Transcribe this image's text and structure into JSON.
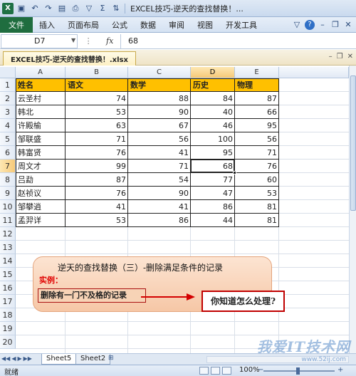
{
  "window": {
    "title": "EXCEL技巧-逆天的查找替换！..."
  },
  "quick_access": {
    "icons": [
      "excel-icon",
      "save-icon",
      "undo-icon",
      "redo-icon",
      "filter-icon",
      "print-icon",
      "sum-icon",
      "sort-icon"
    ]
  },
  "ribbon": {
    "file_label": "文件",
    "tabs": [
      "插入",
      "页面布局",
      "公式",
      "数据",
      "审阅",
      "视图",
      "开发工具"
    ]
  },
  "formula_bar": {
    "name_box": "D7",
    "fx": "fx",
    "value": "68"
  },
  "workbook": {
    "tab_label": "EXCEL技巧-逆天的查找替换！.xlsx"
  },
  "grid": {
    "columns": [
      "A",
      "B",
      "C",
      "D",
      "E"
    ],
    "rows": [
      "1",
      "2",
      "3",
      "4",
      "5",
      "6",
      "7",
      "8",
      "9",
      "10",
      "11",
      "12",
      "13",
      "14",
      "15",
      "16",
      "17",
      "18",
      "19",
      "20"
    ],
    "selected_cell": "D7",
    "headers": [
      "姓名",
      "语文",
      "数学",
      "历史",
      "物理"
    ],
    "records": [
      {
        "name": "云圣村",
        "values": [
          "74",
          "88",
          "84",
          "87"
        ]
      },
      {
        "name": "韩北",
        "values": [
          "53",
          "90",
          "40",
          "66"
        ]
      },
      {
        "name": "许殿榆",
        "values": [
          "63",
          "67",
          "46",
          "95"
        ]
      },
      {
        "name": "邹联盛",
        "values": [
          "71",
          "56",
          "100",
          "56"
        ]
      },
      {
        "name": "韩富贤",
        "values": [
          "76",
          "41",
          "95",
          "71"
        ]
      },
      {
        "name": "周文才",
        "values": [
          "99",
          "71",
          "68",
          "76"
        ]
      },
      {
        "name": "吕勐",
        "values": [
          "87",
          "54",
          "77",
          "60"
        ]
      },
      {
        "name": "赵祯议",
        "values": [
          "76",
          "90",
          "47",
          "53"
        ]
      },
      {
        "name": "邹攀逍",
        "values": [
          "41",
          "41",
          "86",
          "81"
        ]
      },
      {
        "name": "孟羿详",
        "values": [
          "53",
          "86",
          "44",
          "81"
        ]
      }
    ]
  },
  "callout": {
    "title": "逆天的查找替换（三）-删除满足条件的记录",
    "subtitle": "实例：",
    "box_text": "删除有一门不及格的记录",
    "answer": "你知道怎么处理?"
  },
  "sheets": {
    "tabs": [
      "Sheet5",
      "Sheet2"
    ],
    "active": "Sheet5"
  },
  "status": {
    "text": "就绪",
    "zoom": "100%"
  },
  "watermark": {
    "text": "我爱IT技术网",
    "url": "www.52ij.com"
  },
  "colors": {
    "header_fill": "#ffc000",
    "accent_red": "#c00000",
    "file_tab": "#1f6d3f"
  }
}
